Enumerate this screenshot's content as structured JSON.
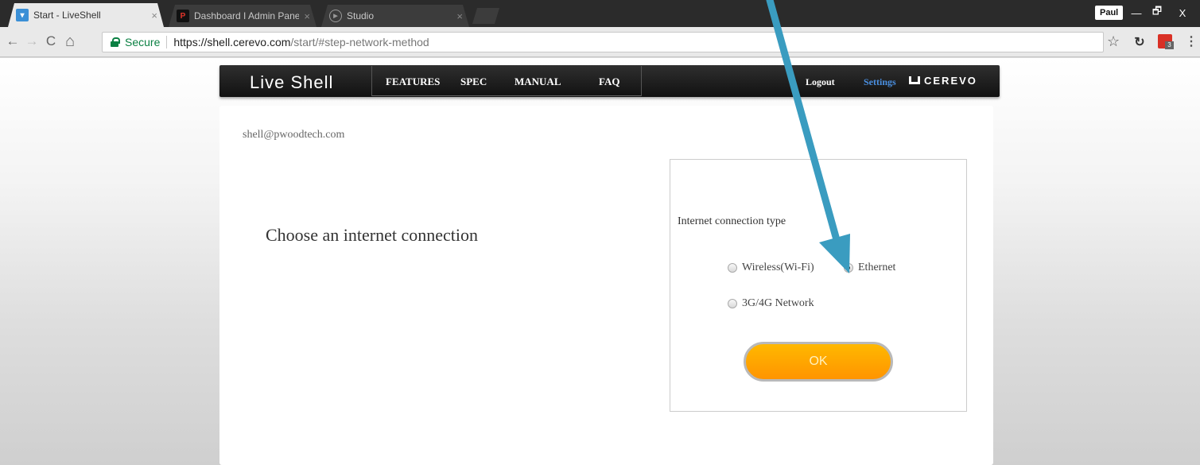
{
  "browser": {
    "tabs": [
      {
        "label": "Start - LiveShell",
        "close": "×"
      },
      {
        "label": "Dashboard I Admin Pane",
        "close": "×"
      },
      {
        "label": "Studio",
        "close": "×"
      }
    ],
    "profile_name": "Paul",
    "window_controls": {
      "minimize": "—",
      "restore": "🗗",
      "close": "X"
    },
    "nav": {
      "back": "←",
      "forward": "→",
      "reload": "C",
      "home": "⌂"
    },
    "omnibox": {
      "secure_label": "Secure",
      "url_host": "https://shell.cerevo.com",
      "url_path": "/start/#step-network-method"
    },
    "extension_badge": "3"
  },
  "site": {
    "brand": "Live Shell",
    "nav_items": [
      "FEATURES",
      "SPEC",
      "MANUAL",
      "FAQ"
    ],
    "logout_label": "Logout",
    "settings_label": "Settings",
    "logo_text": "CEREVO"
  },
  "page": {
    "account_email": "shell@pwoodtech.com",
    "heading": "Choose an internet connection",
    "connection_type_label": "Internet connection type",
    "options": [
      {
        "label": "Wireless(Wi-Fi)",
        "selected": false
      },
      {
        "label": "Ethernet",
        "selected": true
      },
      {
        "label": "3G/4G Network",
        "selected": false
      }
    ],
    "ok_label": "OK"
  },
  "colors": {
    "annotation_arrow": "#3a9cc0",
    "ok_button": "#ffa800",
    "settings_link": "#4a90e2",
    "secure_green": "#0b8043"
  }
}
